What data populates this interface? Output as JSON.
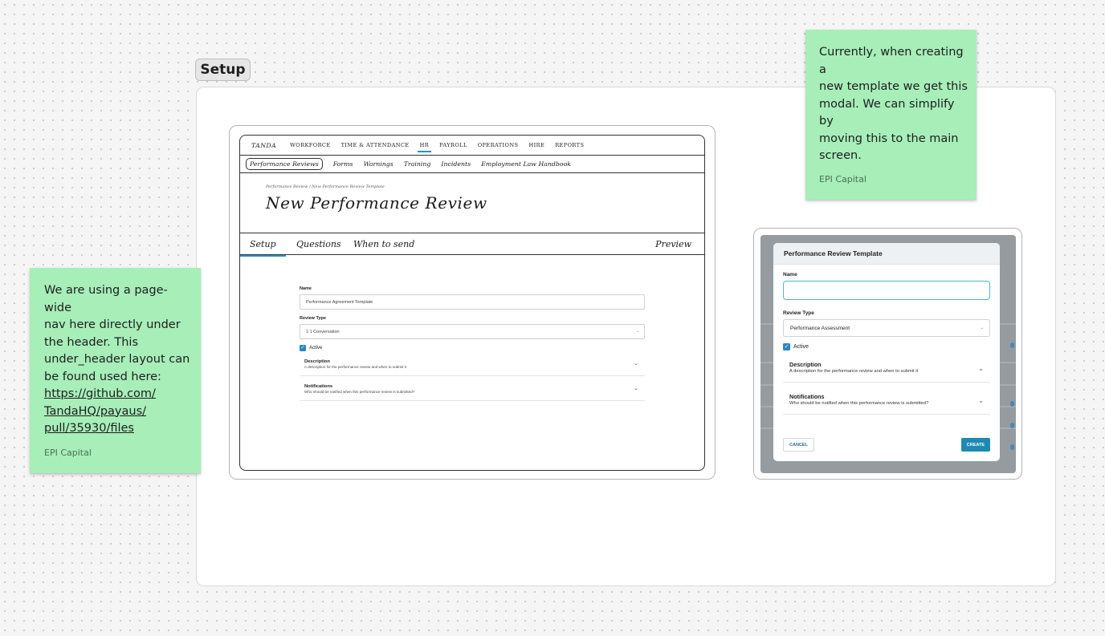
{
  "section": {
    "label": "Setup"
  },
  "sticky_left": {
    "lines": [
      "We are using a page-wide",
      "nav here directly under",
      "the header. This",
      "under_header layout can",
      "be found used here:"
    ],
    "link_lines": [
      "https://github.com/",
      "TandaHQ/payaus/",
      "pull/35930/files"
    ],
    "author": "EPI Capital"
  },
  "sticky_right": {
    "lines": [
      "Currently, when creating a",
      "new template we get this",
      "modal. We can simplify by",
      "moving this to the main",
      "screen."
    ],
    "author": "EPI Capital"
  },
  "wireframe": {
    "logo": "TANDA",
    "top_nav": [
      "WORKFORCE",
      "TIME & ATTENDANCE",
      "HR",
      "PAYROLL",
      "OPERATIONS",
      "HIRE",
      "REPORTS"
    ],
    "active_top_nav": "HR",
    "sub_nav": [
      "Performance Reviews",
      "Forms",
      "Warnings",
      "Training",
      "Incidents",
      "Employment Law Handbook"
    ],
    "breadcrumb": "Performance Review / New Performance Review Template",
    "title": "New Performance Review",
    "tabs": [
      "Setup",
      "Questions",
      "When to send"
    ],
    "preview_tab": "Preview",
    "form": {
      "name_label": "Name",
      "name_value": "Performance Agreement Template",
      "review_type_label": "Review Type",
      "review_type_value": "1:1 Conversation",
      "active_label": "Active",
      "accordions": [
        {
          "title": "Description",
          "desc": "A description for the performance review and when to submit it"
        },
        {
          "title": "Notifications",
          "desc": "Who should be notified when this performance review is submitted?"
        }
      ]
    }
  },
  "modal": {
    "title": "Performance Review Template",
    "name_label": "Name",
    "name_value": "",
    "review_type_label": "Review Type",
    "review_type_value": "Performance Assessment",
    "active_label": "Active",
    "accordions": [
      {
        "title": "Description",
        "desc": "A description for the performance review and when to submit it"
      },
      {
        "title": "Notifications",
        "desc": "Who should be notified when this performance review is submitted?"
      }
    ],
    "cancel_label": "CANCEL",
    "create_label": "CREATE"
  },
  "colors": {
    "sticky": "#a7eeb9",
    "accent_blue": "#2a86c6",
    "input_focus": "#4fb8c9",
    "create_button": "#1e8ab3"
  }
}
